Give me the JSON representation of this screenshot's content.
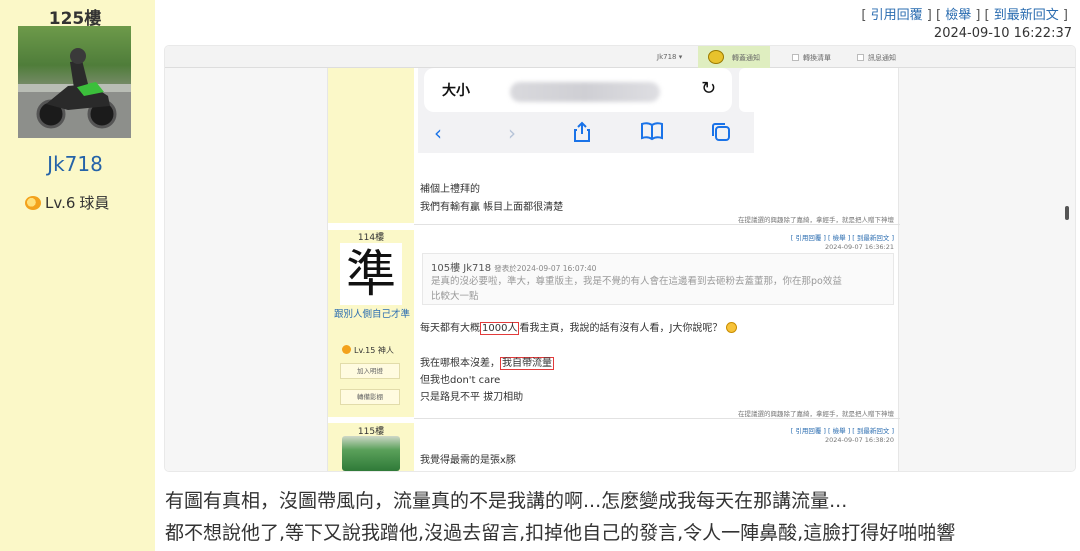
{
  "post": {
    "floor": "125樓",
    "username": "Jk718",
    "level": "Lv.6",
    "rank": "球員",
    "links": {
      "quote": "引用回覆",
      "report": "檢舉",
      "latest": "到最新回文"
    },
    "time": "2024-09-10 16:22:37",
    "caption_line1": "有圖有真相，沒圖帶風向，流量真的不是我講的啊...怎麼變成我每天在那講流量...",
    "caption_line2": "都不想說他了,等下又說我蹭他,沒過去留言,扣掉他自己的發言,令人一陣鼻酸,這臉打得好啪啪響"
  },
  "screenshot": {
    "topbar": {
      "user": "Jk718 ▾",
      "notice": "轉蓋通知",
      "draft": "轉換清單",
      "msg": "訊息通知"
    },
    "safari": {
      "size": "大小",
      "reload_icon": "reload-icon"
    },
    "reply_above": {
      "line1": "補個上禮拜的",
      "line2": "我們有輸有贏 帳目上面都很清楚",
      "footer": "在提議選的興趣除了嘉綺，拿經手，就是把人贈下神壇"
    },
    "floor114": {
      "floor": "114樓",
      "avatar_char": "準",
      "nickname": "跟別人側自己才準",
      "level": "Lv.15",
      "rank": "神人",
      "btn_friend": "加入明燈",
      "btn_album": "轉備影棚",
      "links": "[ 引用回覆 ] [ 檢舉 ] [ 到最新回文 ]",
      "time": "2024-09-07 16:36:21",
      "quote_head": "105樓 Jk718",
      "quote_meta": "發表於2024-09-07 16:07:40",
      "quote_line1": "是真的沒必要啦，準大，尊重版主，我是不覺的有人會在這邊看到去砸粉去蓋董那，你在那po效益",
      "quote_line2": "比較大一點",
      "body_pre": "每天都有大概",
      "body_hl": "1000人",
      "body_post": "看我主頁，我說的話有沒有人看，J大你說呢？",
      "line2_pre": "我在哪根本沒差，",
      "line2_hl": "我自帶流量",
      "line3": "但我也don't care",
      "line4": "只是路見不平 拔刀相助",
      "footer": "在提議選的興趣除了嘉綺，拿經手，就是把人贈下神壇"
    },
    "floor115": {
      "floor": "115樓",
      "links": "[ 引用回覆 ] [ 檢舉 ] [ 到最新回文 ]",
      "time": "2024-09-07 16:38:20",
      "body": "我覺得最需的是張x豚"
    }
  }
}
